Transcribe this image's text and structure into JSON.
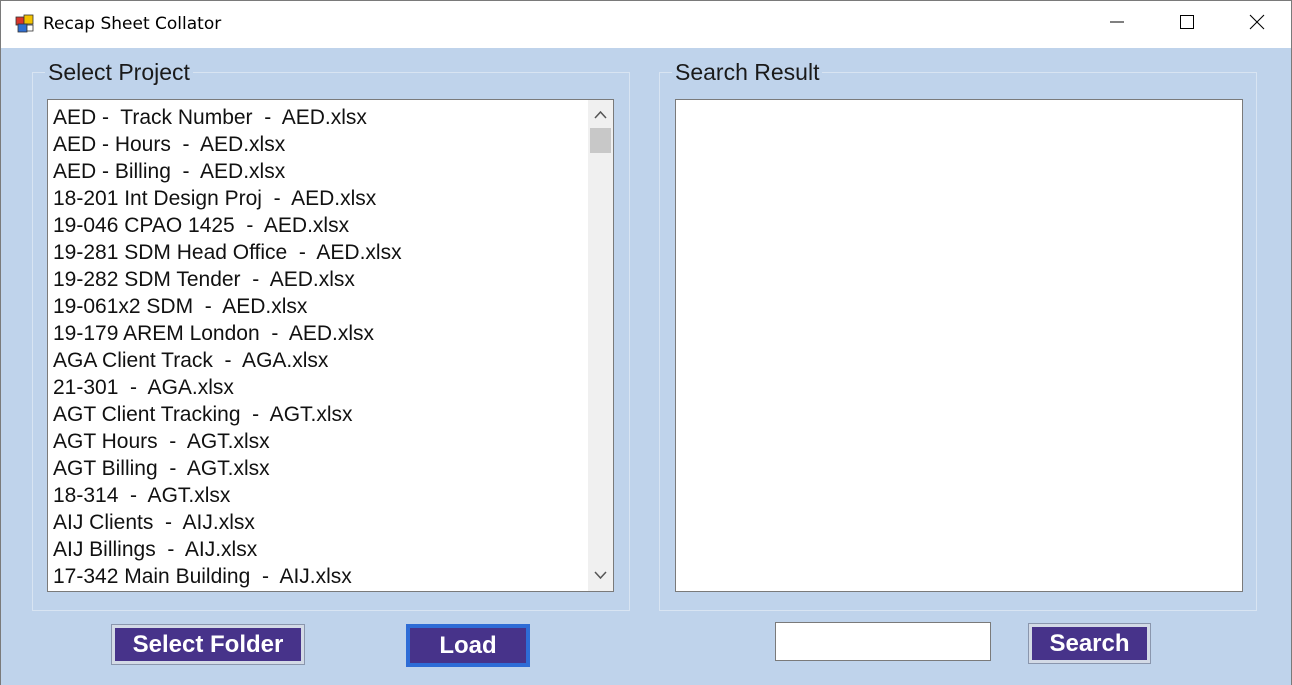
{
  "window": {
    "title": "Recap Sheet Collator",
    "icon": "app-icon",
    "controls": [
      "minimize-icon",
      "maximize-icon",
      "close-icon"
    ]
  },
  "select_project": {
    "label": "Select Project",
    "items": [
      "AED -  Track Number  -  AED.xlsx",
      "AED - Hours  -  AED.xlsx",
      "AED - Billing  -  AED.xlsx",
      "18-201 Int Design Proj  -  AED.xlsx",
      "19-046 CPAO 1425  -  AED.xlsx",
      "19-281 SDM Head Office  -  AED.xlsx",
      "19-282 SDM Tender  -  AED.xlsx",
      "19-061x2 SDM  -  AED.xlsx",
      "19-179 AREM London  -  AED.xlsx",
      "AGA Client Track  -  AGA.xlsx",
      "21-301  -  AGA.xlsx",
      "AGT Client Tracking  -  AGT.xlsx",
      "AGT Hours  -  AGT.xlsx",
      "AGT Billing  -  AGT.xlsx",
      "18-314  -  AGT.xlsx",
      "AIJ Clients  -  AIJ.xlsx",
      "AIJ Billings  -  AIJ.xlsx",
      "17-342 Main Building  -  AIJ.xlsx"
    ]
  },
  "search_result": {
    "label": "Search Result",
    "items": []
  },
  "buttons": {
    "select_folder": "Select Folder",
    "load": "Load",
    "search": "Search"
  },
  "search": {
    "value": ""
  },
  "colors": {
    "background": "#bfd3eb",
    "button": "#47338a",
    "button_text": "#ffffff"
  }
}
